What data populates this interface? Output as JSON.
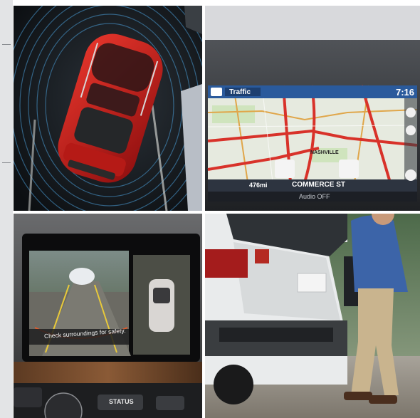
{
  "nav_screen": {
    "header_label": "Traffic",
    "time": "7:16",
    "distance": "476mi",
    "street": "COMMERCE ST",
    "footer_label": "Audio OFF",
    "map_label": "NASHVILLE"
  },
  "camera_screen": {
    "warning_text": "Check surroundings for safety."
  },
  "console": {
    "status_button_label": "STATUS"
  },
  "colors": {
    "vehicle_red": "#c41a1a",
    "nav_header_blue": "#2a5a9c",
    "map_road_red": "#d8322a",
    "parking_guide_yellow": "#e8c93a"
  }
}
